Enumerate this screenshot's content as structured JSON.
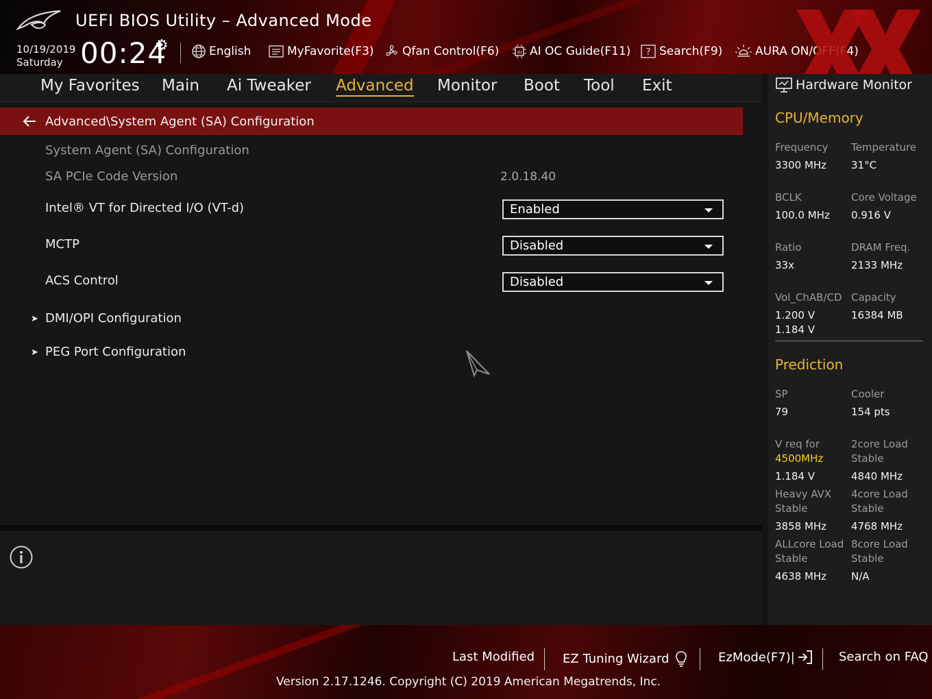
{
  "header": {
    "title": "UEFI BIOS Utility – Advanced Mode",
    "date": "10/19/2019",
    "day": "Saturday",
    "time": "00:24",
    "toolbar": {
      "language": "English",
      "my_favorite": "MyFavorite(F3)",
      "qfan": "Qfan Control(F6)",
      "ai_oc": "AI OC Guide(F11)",
      "search": "Search(F9)",
      "aura": "AURA ON/OFF(F4)"
    }
  },
  "nav": {
    "tabs": [
      "My Favorites",
      "Main",
      "Ai Tweaker",
      "Advanced",
      "Monitor",
      "Boot",
      "Tool",
      "Exit"
    ],
    "active": "Advanced"
  },
  "main": {
    "breadcrumb": "Advanced\\System Agent (SA) Configuration",
    "section_heading": "System Agent (SA) Configuration",
    "pcie_label": "SA PCIe Code Version",
    "pcie_value": "2.0.18.40",
    "vtd_label": "Intel® VT for Directed I/O (VT-d)",
    "vtd_value": "Enabled",
    "mctp_label": "MCTP",
    "mctp_value": "Disabled",
    "acs_label": "ACS Control",
    "acs_value": "Disabled",
    "dmi_label": "DMI/OPI Configuration",
    "peg_label": "PEG Port Configuration"
  },
  "hw_monitor": {
    "title": "Hardware Monitor",
    "cpu_memory": {
      "heading": "CPU/Memory",
      "frequency_label": "Frequency",
      "frequency_value": "3300 MHz",
      "temperature_label": "Temperature",
      "temperature_value": "31°C",
      "bclk_label": "BCLK",
      "bclk_value": "100.0 MHz",
      "core_voltage_label": "Core Voltage",
      "core_voltage_value": "0.916 V",
      "ratio_label": "Ratio",
      "ratio_value": "33x",
      "dram_label": "DRAM Freq.",
      "dram_value": "2133 MHz",
      "vol_label": "Vol_ChAB/CD",
      "vol_value1": "1.200 V",
      "vol_value2": "1.184 V",
      "capacity_label": "Capacity",
      "capacity_value": "16384 MB"
    },
    "prediction": {
      "heading": "Prediction",
      "sp_label": "SP",
      "sp_value": "79",
      "cooler_label": "Cooler",
      "cooler_value": "154 pts",
      "vreq_label": "V req for",
      "vreq_freq": "4500MHz",
      "vreq_value": "1.184 V",
      "core2_label1": "2core Load",
      "core2_label2": "Stable",
      "core2_value": "4840 MHz",
      "avx_label1": "Heavy AVX",
      "avx_label2": "Stable",
      "avx_value": "3858 MHz",
      "core4_label1": "4core Load",
      "core4_label2": "Stable",
      "core4_value": "4768 MHz",
      "allcore_label1": "ALLcore Load",
      "allcore_label2": "Stable",
      "allcore_value": "4638 MHz",
      "core8_label1": "8core Load",
      "core8_label2": "Stable",
      "core8_value": "N/A"
    }
  },
  "footer": {
    "last_modified": "Last Modified",
    "ez_tuning": "EZ Tuning Wizard",
    "ezmode": "EzMode(F7)|",
    "faq": "Search on FAQ",
    "version": "Version 2.17.1246. Copyright (C) 2019 American Megatrends, Inc."
  },
  "colors": {
    "accent_gold": "#e8b530",
    "breadcrumb_red": "#7a1111",
    "highlight_yellow": "#f0d020"
  },
  "icons": [
    "rog-logo-icon",
    "gear-icon",
    "globe-icon",
    "favorite-list-icon",
    "fan-icon",
    "ai-chip-icon",
    "search-help-icon",
    "aura-light-icon",
    "back-arrow-icon",
    "chevron-right-icon",
    "dropdown-caret-icon",
    "info-icon",
    "monitor-icon",
    "lightbulb-icon",
    "exit-arrow-icon",
    "mouse-pointer-icon"
  ]
}
